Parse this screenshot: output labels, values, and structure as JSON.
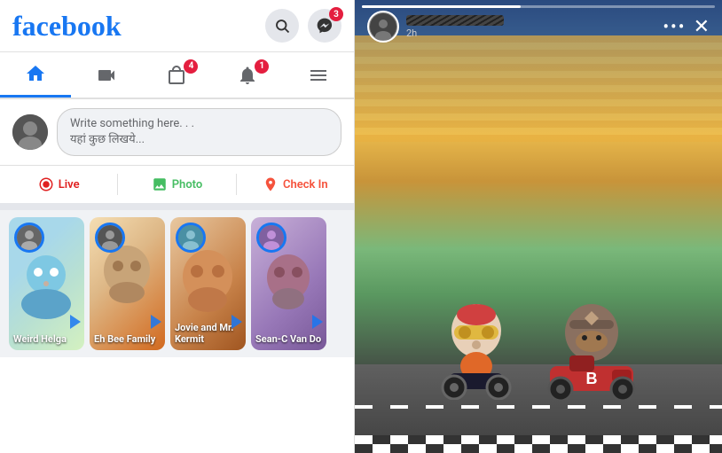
{
  "app": {
    "name": "facebook"
  },
  "header": {
    "search_icon": "🔍",
    "messenger_icon": "💬",
    "messenger_badge": "3"
  },
  "nav": {
    "tabs": [
      {
        "id": "home",
        "icon": "🏠",
        "active": true,
        "badge": null
      },
      {
        "id": "video",
        "icon": "▶",
        "active": false,
        "badge": null
      },
      {
        "id": "marketplace",
        "icon": "🛒",
        "active": false,
        "badge": "4"
      },
      {
        "id": "notifications",
        "icon": "🔔",
        "active": false,
        "badge": "1"
      },
      {
        "id": "menu",
        "icon": "☰",
        "active": false,
        "badge": null
      }
    ]
  },
  "post_box": {
    "placeholder_line1": "Write something here. . .",
    "placeholder_line2": "यहां कुछ लिखये..."
  },
  "action_bar": {
    "live_label": "Live",
    "photo_label": "Photo",
    "checkin_label": "Check In"
  },
  "stories": [
    {
      "id": 1,
      "user": "Weird Helga",
      "has_arrow": true
    },
    {
      "id": 2,
      "user": "Eh Bee Family",
      "has_arrow": true
    },
    {
      "id": 3,
      "user": "Jovie and Mr. Kermit",
      "has_arrow": true
    },
    {
      "id": 4,
      "user": "Sean-C Van Do",
      "has_arrow": true
    }
  ],
  "story_viewer": {
    "time": "2h",
    "dots": "•••",
    "close": "✕",
    "kart_label": "B",
    "progress_pct": 45
  }
}
